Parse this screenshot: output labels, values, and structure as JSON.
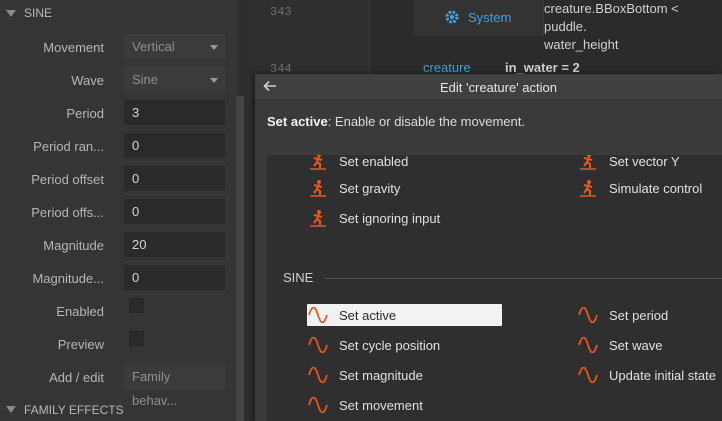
{
  "props": {
    "section_title": "SINE",
    "family_section_title": "FAMILY EFFECTS",
    "rows": [
      {
        "label": "Movement",
        "value": "Vertical"
      },
      {
        "label": "Wave",
        "value": "Sine"
      },
      {
        "label": "Period",
        "value": "3"
      },
      {
        "label": "Period ran...",
        "value": "0"
      },
      {
        "label": "Period offset",
        "value": "0"
      },
      {
        "label": "Period offs...",
        "value": "0"
      },
      {
        "label": "Magnitude",
        "value": "20"
      },
      {
        "label": "Magnitude...",
        "value": "0"
      },
      {
        "label": "Enabled",
        "value": ""
      },
      {
        "label": "Preview",
        "value": ""
      },
      {
        "label": "Add / edit",
        "value": "Family behav..."
      }
    ]
  },
  "sheet": {
    "line_numbers": [
      "343",
      "344"
    ],
    "system_label": "System",
    "condition_line1": "creature.BBoxBottom < puddle.",
    "condition_line2": "water_height",
    "object_label": "creature",
    "action_text": "in_water = 2"
  },
  "dialog": {
    "title": "Edit 'creature' action",
    "desc_bold": "Set active",
    "desc_rest": ": Enable or disable the movement.",
    "behavior_actions": [
      {
        "label": "Set enabled",
        "col": 1
      },
      {
        "label": "Set vector Y",
        "col": 2
      },
      {
        "label": "Set gravity",
        "col": 1
      },
      {
        "label": "Simulate control",
        "col": 2
      },
      {
        "label": "Set ignoring input",
        "col": 1
      }
    ],
    "sine_section_title": "SINE",
    "sine_actions": [
      {
        "label": "Set active",
        "col": 1,
        "selected": true
      },
      {
        "label": "Set period",
        "col": 2
      },
      {
        "label": "Set cycle position",
        "col": 1
      },
      {
        "label": "Set wave",
        "col": 2
      },
      {
        "label": "Set magnitude",
        "col": 1
      },
      {
        "label": "Update initial state",
        "col": 2
      },
      {
        "label": "Set movement",
        "col": 1
      }
    ]
  },
  "colors": {
    "accent_orange": "#e8591c",
    "system_blue": "#3aa3e0",
    "selected_bg": "#f2f2f2"
  }
}
